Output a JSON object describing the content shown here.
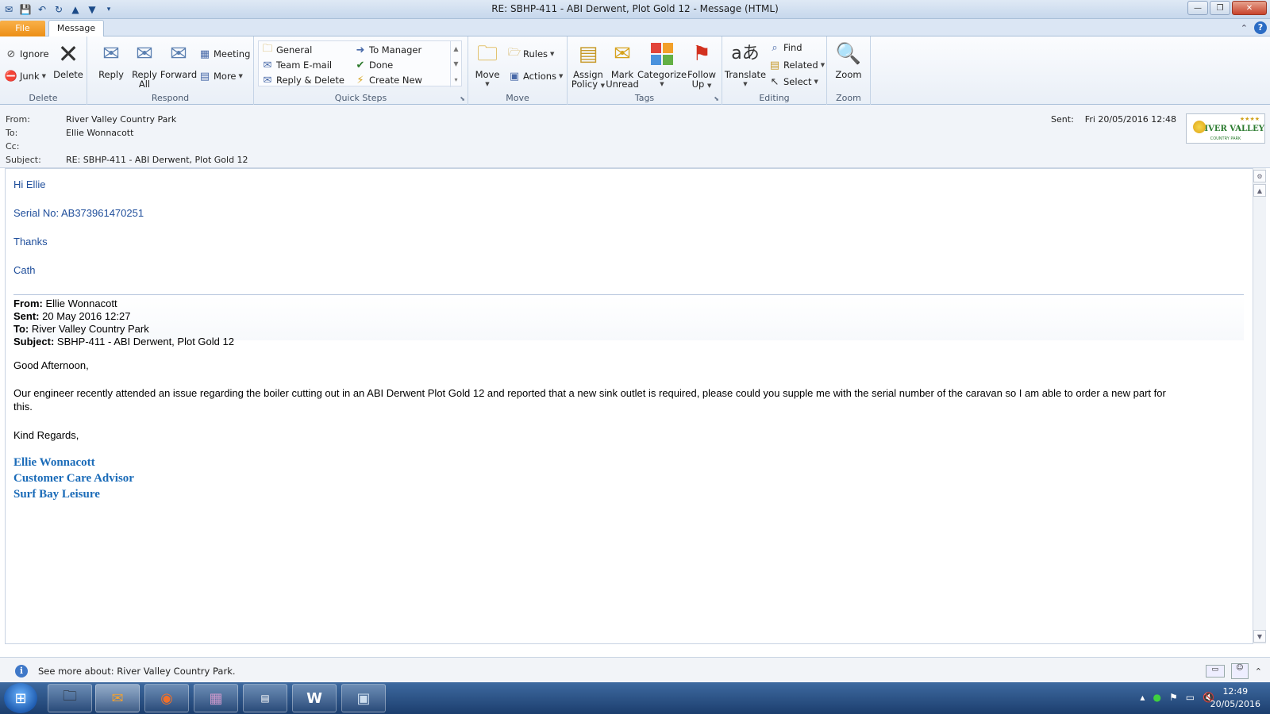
{
  "window": {
    "title": "RE: SBHP-411 - ABI Derwent, Plot Gold 12  -  Message (HTML)"
  },
  "tabs": {
    "file": "File",
    "message": "Message"
  },
  "ribbon": {
    "delete_group": {
      "ignore": "Ignore",
      "junk": "Junk",
      "delete": "Delete",
      "label": "Delete"
    },
    "respond_group": {
      "reply": "Reply",
      "reply_all_1": "Reply",
      "reply_all_2": "All",
      "forward": "Forward",
      "meeting": "Meeting",
      "more": "More",
      "label": "Respond"
    },
    "quick_steps": {
      "general": "General",
      "team_email": "Team E-mail",
      "reply_delete": "Reply & Delete",
      "to_manager": "To Manager",
      "done": "Done",
      "create_new": "Create New",
      "label": "Quick Steps"
    },
    "move_group": {
      "move": "Move",
      "rules": "Rules",
      "actions": "Actions",
      "label": "Move"
    },
    "tags_group": {
      "assign_1": "Assign",
      "assign_2": "Policy",
      "mark_1": "Mark",
      "mark_2": "Unread",
      "categorize": "Categorize",
      "follow_1": "Follow",
      "follow_2": "Up",
      "label": "Tags"
    },
    "editing_group": {
      "translate": "Translate",
      "find": "Find",
      "related": "Related",
      "select": "Select",
      "label": "Editing"
    },
    "zoom_group": {
      "zoom": "Zoom",
      "label": "Zoom"
    }
  },
  "header": {
    "from_label": "From:",
    "from_value": "River Valley Country Park",
    "to_label": "To:",
    "to_value": "Ellie Wonnacott",
    "cc_label": "Cc:",
    "subject_label": "Subject:",
    "subject_value": "RE: SBHP-411 - ABI Derwent, Plot Gold 12",
    "sent_label": "Sent:",
    "sent_value": "Fri 20/05/2016 12:48",
    "logo_text": "RIVER VALLEY",
    "logo_sub": "COUNTRY PARK",
    "logo_stars": "★★★★"
  },
  "body": {
    "greeting": "Hi Ellie",
    "serial": "Serial No: AB373961470251",
    "thanks": "Thanks",
    "signoff": "Cath",
    "quoted": {
      "from_label": "From:",
      "from_value": "Ellie Wonnacott",
      "sent_label": "Sent:",
      "sent_value": "20 May 2016 12:27",
      "to_label": "To:",
      "to_value": "River Valley Country Park",
      "subject_label": "Subject:",
      "subject_value": "SBHP-411 - ABI Derwent, Plot Gold 12",
      "greeting": "Good Afternoon,",
      "paragraph_1": "Our engineer recently attended an issue regarding the boiler cutting out in an ABI Derwent Plot Gold 12 and reported that a new sink outlet is required, please could you supple me with the serial number of the caravan so I am able to order a new part for",
      "paragraph_2": "this.",
      "closing": "Kind Regards,",
      "sig_name": "Ellie Wonnacott",
      "sig_title": "Customer Care Advisor",
      "sig_company": "Surf Bay Leisure"
    }
  },
  "people_pane": {
    "see_more": "See more about: River Valley Country Park."
  },
  "taskbar": {
    "time": "12:49",
    "date": "20/05/2016"
  }
}
